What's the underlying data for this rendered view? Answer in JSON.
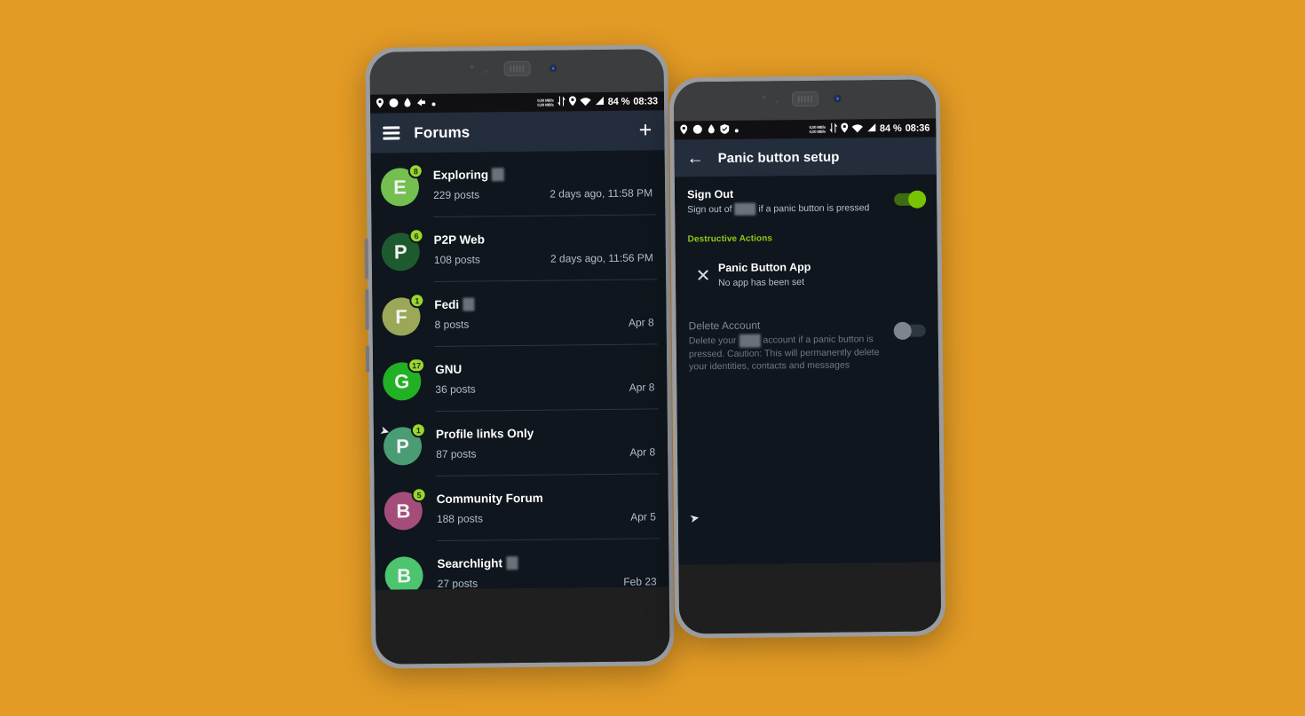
{
  "background_color": "#e39b25",
  "phone_left": {
    "status_bar": {
      "icons_left": [
        "location-pin-icon",
        "circle-icon",
        "droplet-icon",
        "arrow-icon",
        "dot-icon"
      ],
      "net_speed_up": "0,00 MB/s",
      "net_speed_down": "0,00 MB/s",
      "icons_right": [
        "data-transfer-icon",
        "location-pin-icon",
        "wifi-icon",
        "signal-icon"
      ],
      "battery": "84 %",
      "time": "08:33"
    },
    "appbar": {
      "menu_icon": "hamburger-menu-icon",
      "title": "Forums",
      "add_icon": "plus-icon"
    },
    "forums": [
      {
        "letter": "E",
        "color": "#74bf4f",
        "badge": "8",
        "title": "Exploring",
        "redacted_suffix": true,
        "posts": "229 posts",
        "date": "2 days ago, 11:58 PM"
      },
      {
        "letter": "P",
        "color": "#1d5b2e",
        "badge": "6",
        "title": "P2P Web",
        "redacted_suffix": false,
        "posts": "108 posts",
        "date": "2 days ago, 11:56 PM"
      },
      {
        "letter": "F",
        "color": "#9aa858",
        "badge": "1",
        "title": "Fedi",
        "redacted_suffix": true,
        "posts": "8 posts",
        "date": "Apr 8"
      },
      {
        "letter": "G",
        "color": "#22b024",
        "badge": "17",
        "title": "GNU",
        "redacted_suffix": false,
        "posts": "36 posts",
        "date": "Apr 8"
      },
      {
        "letter": "P",
        "color": "#4a9c74",
        "badge": "1",
        "title": "Profile links Only",
        "redacted_suffix": false,
        "posts": "87 posts",
        "date": "Apr 8"
      },
      {
        "letter": "B",
        "color": "#a54d7a",
        "badge": "5",
        "title": "Community Forum",
        "redacted_suffix": false,
        "posts": "188 posts",
        "date": "Apr 5"
      },
      {
        "letter": "B",
        "color": "#4cc56e",
        "badge": "",
        "title": "Searchlight",
        "redacted_suffix": true,
        "posts": "27 posts",
        "date": "Feb 23"
      }
    ]
  },
  "phone_right": {
    "status_bar": {
      "icons_left": [
        "location-pin-icon",
        "circle-icon",
        "droplet-icon",
        "shield-icon",
        "dot-icon"
      ],
      "net_speed_up": "0,00 MB/s",
      "net_speed_down": "0,00 MB/s",
      "icons_right": [
        "data-transfer-icon",
        "location-pin-icon",
        "wifi-icon",
        "signal-icon"
      ],
      "battery": "84 %",
      "time": "08:36"
    },
    "appbar": {
      "back_icon": "back-arrow-icon",
      "title": "Panic button setup"
    },
    "sign_out": {
      "title": "Sign Out",
      "subtitle_before": "Sign out of ",
      "subtitle_after": " if a panic button is pressed",
      "toggle_state": "on",
      "toggle_color": "#77c300"
    },
    "section_destructive": {
      "label": "Destructive Actions",
      "label_color": "#8ec916"
    },
    "panic_button_app": {
      "icon": "close-x-icon",
      "title": "Panic Button App",
      "subtitle": "No app has been set"
    },
    "delete_account": {
      "title": "Delete Account",
      "subtitle_before": "Delete your ",
      "subtitle_after": " account if a panic button is pressed. Caution: This will permanently delete your identities, contacts and messages",
      "toggle_state": "off"
    }
  }
}
